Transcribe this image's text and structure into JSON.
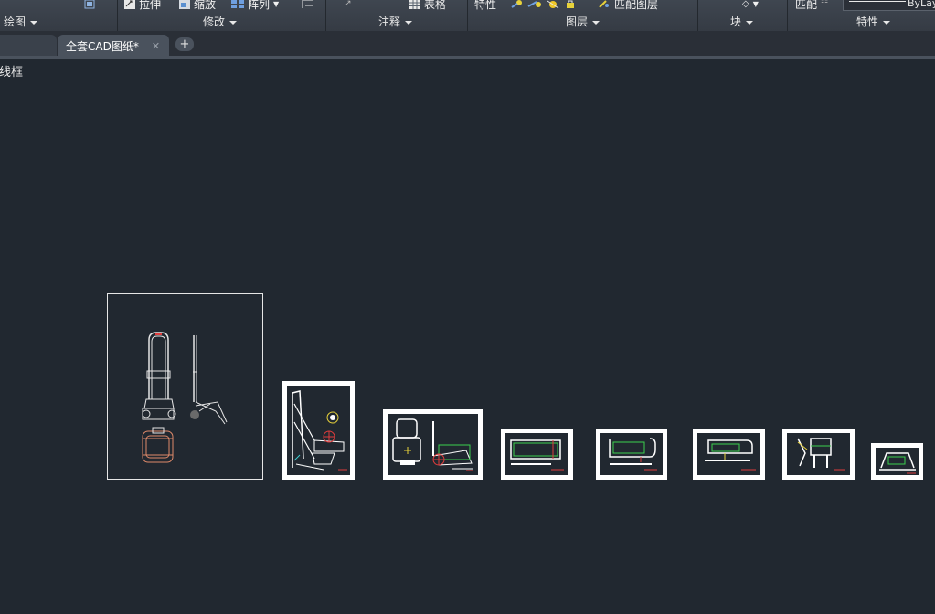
{
  "ribbon": {
    "tools": {
      "stretch": "拉伸",
      "scale": "缩放",
      "array": "阵列",
      "table": "表格",
      "properties": "特性",
      "match_layer": "匹配图层",
      "match": "匹配",
      "bylayer": "ByLay"
    },
    "panels": {
      "draw": "绘图",
      "modify": "修改",
      "annotate": "注释",
      "layers": "图层",
      "block": "块",
      "properties": "特性"
    }
  },
  "tabs": {
    "active": "全套CAD图纸*",
    "add": "+"
  },
  "viewport": {
    "label": "线框"
  },
  "colors": {
    "background": "#212830",
    "ribbon": "#3b424b",
    "sheet": "#ffffff",
    "accent_red": "#e03c3c",
    "accent_green": "#3ccf4e",
    "accent_yellow": "#e8d23a"
  }
}
